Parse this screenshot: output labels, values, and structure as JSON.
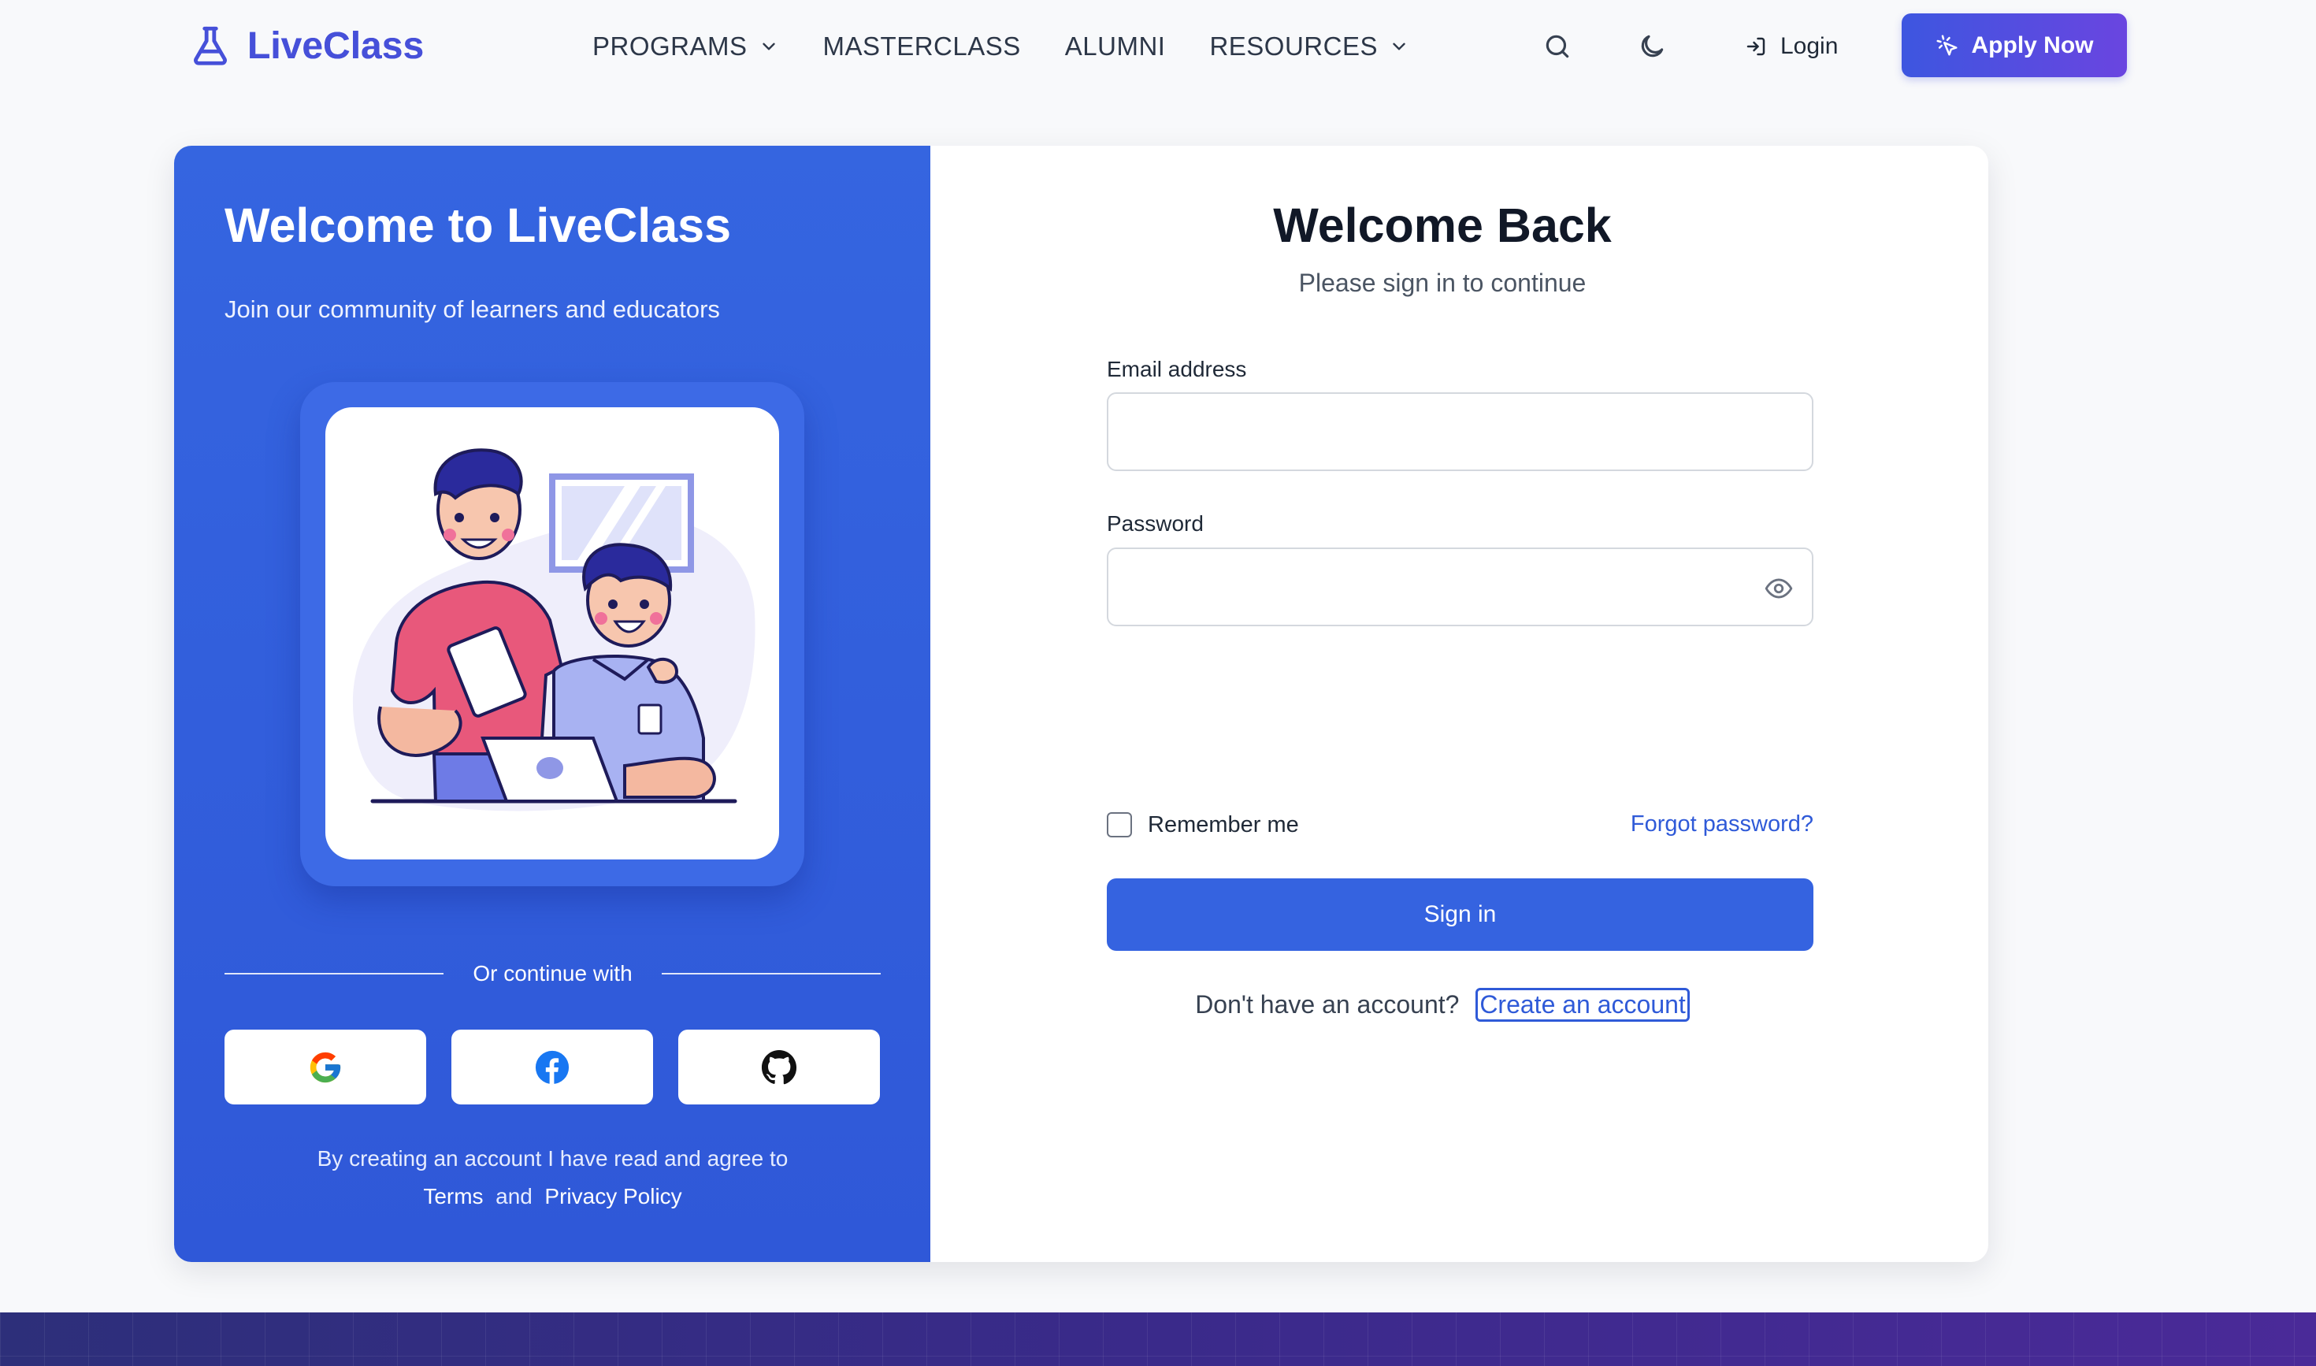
{
  "brand": {
    "name": "LiveClass",
    "color": "#4650d9"
  },
  "nav": {
    "items": [
      {
        "label": "PROGRAMS",
        "has_dropdown": true
      },
      {
        "label": "MASTERCLASS",
        "has_dropdown": false
      },
      {
        "label": "ALUMNI",
        "has_dropdown": false
      },
      {
        "label": "RESOURCES",
        "has_dropdown": true
      }
    ],
    "search_icon": "search-icon",
    "theme_icon": "moon-icon",
    "login_label": "Login",
    "apply_label": "Apply Now"
  },
  "left_panel": {
    "title": "Welcome to LiveClass",
    "subtitle": "Join our community of learners and educators",
    "divider_text": "Or continue with",
    "social": [
      "google-icon",
      "facebook-icon",
      "github-icon"
    ],
    "terms_text": "By creating an account I have read and agree to",
    "terms_link": "Terms",
    "and_text": "and",
    "privacy_link": "Privacy Policy",
    "bg_color": "#3563e0"
  },
  "form": {
    "title": "Welcome Back",
    "subtitle": "Please sign in to continue",
    "email_label": "Email address",
    "email_value": "",
    "password_label": "Password",
    "password_value": "",
    "remember_label": "Remember me",
    "remember_checked": false,
    "forgot_label": "Forgot password?",
    "signin_label": "Sign in",
    "no_account_text": "Don't have an account?",
    "create_account_label": "Create an account",
    "accent_color": "#3563e0"
  }
}
